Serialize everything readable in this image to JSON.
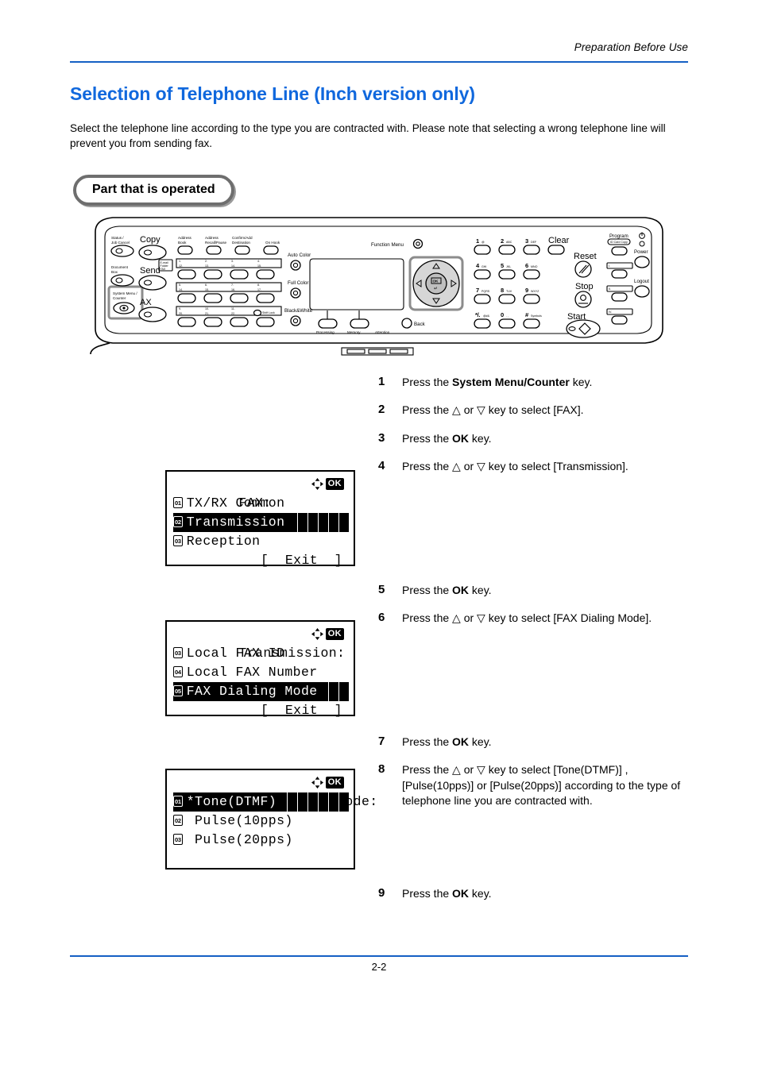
{
  "header": {
    "running_head": "Preparation Before Use",
    "rule_color": "#1560c4"
  },
  "title": "Selection of Telephone Line (Inch version only)",
  "title_color": "#1068dd",
  "intro": "Select the telephone line according to the type you are contracted with. Please note that selecting a wrong telephone line will prevent you from sending fax.",
  "callout": {
    "label": "Part that is operated"
  },
  "control_panel": {
    "left_keys": [
      {
        "label": "Status /\nJob Cancel"
      },
      {
        "label": "Document\nBox"
      },
      {
        "label": "System Menu /\nCounter",
        "highlighted": true
      }
    ],
    "mode_keys": [
      "Copy",
      "Send",
      "FAX"
    ],
    "send_tag": "E-mail\nFolder\nFAX",
    "top_keys": [
      "Address\nBook",
      "Address\nRecall/Pause",
      "Confirm/Add\nDestination",
      "On Hook"
    ],
    "one_touch_rows": [
      [
        "1.",
        "2.",
        "3.",
        "4."
      ],
      [
        "12.",
        "13.",
        "14.",
        "15."
      ],
      [
        "5.",
        "6.",
        "7.",
        "8."
      ],
      [
        "14.",
        "15.",
        "16.",
        "17."
      ],
      [
        "9.",
        "10.",
        "11.",
        ""
      ],
      [
        "20.",
        "21.",
        "22.",
        "Shift Lock"
      ]
    ],
    "color_keys": [
      "Auto Color",
      "Full Color",
      "Black&White"
    ],
    "display_indicators": [
      "Processing",
      "Memory",
      "Attention"
    ],
    "function_menu": "Function Menu",
    "ok_key": "OK",
    "back_key": "Back",
    "numeric_keys": [
      {
        "digit": "1",
        "letters": "@"
      },
      {
        "digit": "2",
        "letters": "ABC"
      },
      {
        "digit": "3",
        "letters": "DEF"
      },
      {
        "digit": "4",
        "letters": "GHI"
      },
      {
        "digit": "5",
        "letters": "JKL"
      },
      {
        "digit": "6",
        "letters": "MNO"
      },
      {
        "digit": "7",
        "letters": "PQRS"
      },
      {
        "digit": "8",
        "letters": "TUV"
      },
      {
        "digit": "9",
        "letters": "WXYZ"
      },
      {
        "digit": "*/.",
        "letters": "@#&"
      },
      {
        "digit": "0",
        "letters": ". ,"
      },
      {
        "digit": "#",
        "letters": "Symbols"
      }
    ],
    "right_keys": [
      "Clear",
      "Reset",
      "Stop",
      "Start"
    ],
    "program_label": "Program",
    "program_sub": "ID Card Copy",
    "quick_keys": [
      "I.",
      "II.",
      "IV."
    ],
    "power_label": "Power",
    "logout_label": "Logout"
  },
  "lcd_screens": [
    {
      "id": "fax-menu",
      "title": "FAX:",
      "items": [
        {
          "num": "01",
          "label": "TX/RX Common",
          "selected": false
        },
        {
          "num": "02",
          "label": "Transmission",
          "selected": true
        },
        {
          "num": "03",
          "label": "Reception",
          "selected": false
        }
      ],
      "softkey": "[  Exit  ]",
      "has_exit": true
    },
    {
      "id": "transmission-menu",
      "title": "Transmission:",
      "items": [
        {
          "num": "03",
          "label": "Local FAX ID",
          "selected": false
        },
        {
          "num": "04",
          "label": "Local FAX Number",
          "selected": false
        },
        {
          "num": "05",
          "label": "FAX Dialing Mode",
          "selected": true
        }
      ],
      "softkey": "[  Exit  ]",
      "has_exit": true
    },
    {
      "id": "fax-dialing-mode-menu",
      "title": "FAX Dialing Mode:",
      "items": [
        {
          "num": "01",
          "label": "*Tone(DTMF)",
          "selected": true
        },
        {
          "num": "02",
          "label": " Pulse(10pps)",
          "selected": false
        },
        {
          "num": "03",
          "label": " Pulse(20pps)",
          "selected": false
        }
      ],
      "softkey": "",
      "has_exit": false
    }
  ],
  "steps": [
    {
      "n": "1",
      "parts": [
        {
          "t": "Press the ",
          "b": false
        },
        {
          "t": "System Menu/Counter",
          "b": true
        },
        {
          "t": " key.",
          "b": false
        }
      ]
    },
    {
      "n": "2",
      "parts": [
        {
          "t": "Press the ",
          "b": false
        },
        {
          "t": "△",
          "b": false
        },
        {
          "t": " or ",
          "b": false
        },
        {
          "t": "▽",
          "b": false
        },
        {
          "t": " key to select [FAX].",
          "b": false
        }
      ]
    },
    {
      "n": "3",
      "parts": [
        {
          "t": "Press the ",
          "b": false
        },
        {
          "t": "OK",
          "b": true
        },
        {
          "t": " key.",
          "b": false
        }
      ]
    },
    {
      "n": "4",
      "parts": [
        {
          "t": "Press the ",
          "b": false
        },
        {
          "t": "△",
          "b": false
        },
        {
          "t": " or ",
          "b": false
        },
        {
          "t": "▽",
          "b": false
        },
        {
          "t": " key to select [Transmission].",
          "b": false
        }
      ]
    },
    {
      "n": "5",
      "parts": [
        {
          "t": "Press the ",
          "b": false
        },
        {
          "t": "OK",
          "b": true
        },
        {
          "t": " key.",
          "b": false
        }
      ]
    },
    {
      "n": "6",
      "parts": [
        {
          "t": "Press the ",
          "b": false
        },
        {
          "t": "△",
          "b": false
        },
        {
          "t": " or ",
          "b": false
        },
        {
          "t": "▽",
          "b": false
        },
        {
          "t": " key to select [FAX Dialing Mode].",
          "b": false
        }
      ]
    },
    {
      "n": "7",
      "parts": [
        {
          "t": "Press the ",
          "b": false
        },
        {
          "t": "OK",
          "b": true
        },
        {
          "t": " key.",
          "b": false
        }
      ]
    },
    {
      "n": "8",
      "parts": [
        {
          "t": "Press the ",
          "b": false
        },
        {
          "t": "△",
          "b": false
        },
        {
          "t": " or ",
          "b": false
        },
        {
          "t": "▽",
          "b": false
        },
        {
          "t": " key to select [Tone(DTMF)] , [Pulse(10pps)] or [Pulse(20pps)] according to the type of telephone line you are contracted with.",
          "b": false
        }
      ]
    },
    {
      "n": "9",
      "parts": [
        {
          "t": "Press the ",
          "b": false
        },
        {
          "t": "OK",
          "b": true
        },
        {
          "t": " key.",
          "b": false
        }
      ]
    }
  ],
  "footer": {
    "page_number": "2-2"
  }
}
